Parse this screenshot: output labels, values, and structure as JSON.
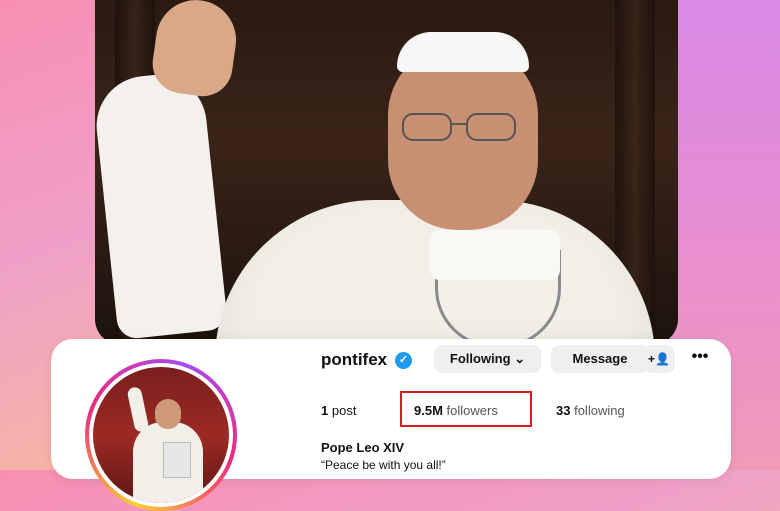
{
  "profile": {
    "username": "pontifex",
    "verified_icon": "verified-badge-icon",
    "display_name": "Pope Leo XIV",
    "bio": "“Peace be with you all!”"
  },
  "actions": {
    "following_label": "Following",
    "message_label": "Message",
    "add_user_icon": "+👤",
    "more_icon": "•••"
  },
  "stats": {
    "posts_count": "1",
    "posts_label": "post",
    "followers_count": "9.5M",
    "followers_label": "followers",
    "following_count": "33",
    "following_label": "following"
  },
  "colors": {
    "highlight_box": "#d11f1f",
    "verified_blue": "#1d9bf0"
  }
}
